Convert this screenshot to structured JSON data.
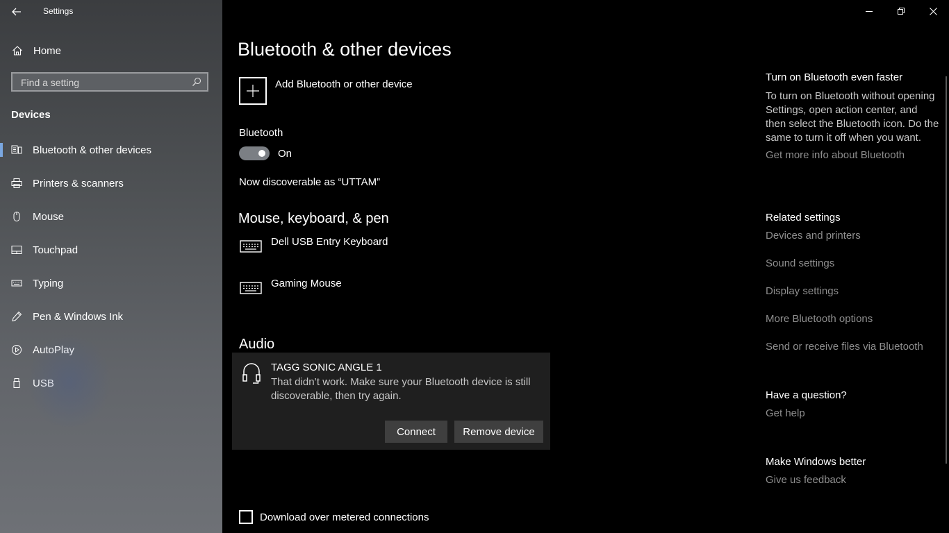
{
  "window": {
    "title": "Settings",
    "minimize_icon": "minimize-icon",
    "restore_icon": "restore-icon",
    "close_icon": "close-icon"
  },
  "sidebar": {
    "home_label": "Home",
    "search_placeholder": "Find a setting",
    "section_title": "Devices",
    "items": [
      {
        "label": "Bluetooth & other devices",
        "icon": "bluetooth-devices-icon",
        "active": true
      },
      {
        "label": "Printers & scanners",
        "icon": "printer-icon"
      },
      {
        "label": "Mouse",
        "icon": "mouse-icon"
      },
      {
        "label": "Touchpad",
        "icon": "touchpad-icon"
      },
      {
        "label": "Typing",
        "icon": "keyboard-icon"
      },
      {
        "label": "Pen & Windows Ink",
        "icon": "pen-icon"
      },
      {
        "label": "AutoPlay",
        "icon": "autoplay-icon"
      },
      {
        "label": "USB",
        "icon": "usb-icon"
      }
    ]
  },
  "main": {
    "title": "Bluetooth & other devices",
    "add_device_label": "Add Bluetooth or other device",
    "bluetooth_label": "Bluetooth",
    "bluetooth_state": "On",
    "discoverable_text": "Now discoverable as “UTTAM”",
    "input_section_title": "Mouse, keyboard, & pen",
    "input_devices": [
      {
        "name": "Dell USB Entry Keyboard",
        "icon": "keyboard-icon"
      },
      {
        "name": "Gaming Mouse",
        "icon": "keyboard-icon"
      }
    ],
    "audio_section_title": "Audio",
    "audio_device": {
      "name": "TAGG SONIC ANGLE 1",
      "message": "That didn’t work. Make sure your Bluetooth device is still discoverable, then try again.",
      "connect_label": "Connect",
      "remove_label": "Remove device",
      "icon": "headphones-icon"
    },
    "metered_label": "Download over metered connections",
    "metered_checked": false
  },
  "right_panel": {
    "faster_title": "Turn on Bluetooth even faster",
    "faster_text": "To turn on Bluetooth without opening Settings, open action center, and then select the Bluetooth icon. Do the same to turn it off when you want.",
    "faster_link": "Get more info about Bluetooth",
    "related_title": "Related settings",
    "related_links": [
      "Devices and printers",
      "Sound settings",
      "Display settings",
      "More Bluetooth options",
      "Send or receive files via Bluetooth"
    ],
    "question_title": "Have a question?",
    "question_link": "Get help",
    "better_title": "Make Windows better",
    "better_link": "Give us feedback"
  },
  "colors": {
    "sidebar_top": "#3b3d40",
    "sidebar_bottom": "#6e7176",
    "main_bg": "#000000",
    "card_bg": "#1f1f1f",
    "button_bg": "#3f3f3f",
    "link_text": "#8e8e8e",
    "active_accent": "#7aa7e0"
  }
}
